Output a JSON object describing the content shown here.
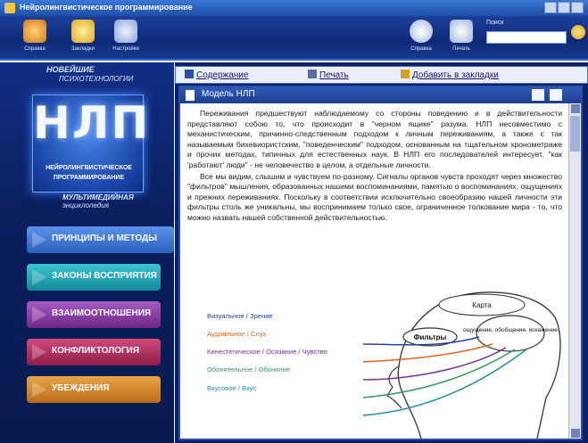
{
  "window": {
    "title": "Нейролингвистическое программирование"
  },
  "toolbar": {
    "buttons": [
      {
        "name": "home",
        "label": "Справка",
        "color": "#f0a437"
      },
      {
        "name": "bookmarks",
        "label": "Закладки",
        "color": "#f4d04b"
      },
      {
        "name": "settings",
        "label": "Настройки",
        "color": "#b9c9ee"
      },
      {
        "name": "help",
        "label": "Справка",
        "color": "#d8e2f7"
      },
      {
        "name": "print",
        "label": "Печать",
        "color": "#d8e2f7"
      }
    ],
    "search_label": "Поиск",
    "search_value": ""
  },
  "brand": {
    "top_line": "НОВЕЙШИЕ",
    "sub_line": "ПСИХОТЕХНОЛОГИИ",
    "logo": "НЛП",
    "logo_line1": "НЕЙРОЛИНГВИСТИЧЕСКОЕ",
    "logo_line2": "ПРОГРАММИРОВАНИЕ",
    "mm_line1": "МУЛЬТИМЕДИЙНАЯ",
    "mm_line2": "энциклопедия"
  },
  "nav": [
    {
      "label": "ПРИНЦИПЫ И МЕТОДЫ",
      "color": "#3f78d8",
      "active": true
    },
    {
      "label": "ЗАКОНЫ ВОСПРИЯТИЯ",
      "color": "#1fa8b8"
    },
    {
      "label": "ВЗАИМООТНОШЕНИЯ",
      "color": "#8a3da6"
    },
    {
      "label": "КОНФЛИКТОЛОГИЯ",
      "color": "#b3285c"
    },
    {
      "label": "УБЕЖДЕНИЯ",
      "color": "#d68a2a"
    }
  ],
  "links": {
    "contents": "Содержание",
    "print": "Печать",
    "bookmark": "Добавить в закладки"
  },
  "document": {
    "title": "Модель НЛП",
    "paragraph1": "Переживания предшествуют наблюдаемому со стороны поведению и в действительности представляют собою то, что происходит в \"черном ящике\" разума. НЛП несовместимо с механистическим, причинно-следственным подходом к личным переживаниям, а также с так называемым бихевиористским, \"поведенческим\" подходом, основанным на тщательном хронометраже и прочих методах, типичных для естественных наук. В НЛП его последователей интересует, \"как 'работают' люди\" - не человечество в целом, а отдельные личности.",
    "paragraph2": "Все мы видим, слышим и чувствуем по-разному. Сигналы органов чувств проходят через множество \"фильтров\" мышления, образованных нашими воспоминаниями, памятью о воспоминаниях, ощущениях и прежних переживаниях. Поскольку в соответствии исключительно своеобразию нашей личности эти фильтры столь же уникальны, мы воспринимаем только свое, ограниченное толкование мира - то, что можно назвать нашей собственной действительностью."
  },
  "legend": [
    {
      "label": "Визуальное / Зрение",
      "color": "#2a3f9c"
    },
    {
      "label": "Аудиальное / Слух",
      "color": "#e2651e"
    },
    {
      "label": "Кинестетическое / Осязание / Чувство",
      "color": "#7a2f94"
    },
    {
      "label": "Обонятельное / Обоняние",
      "color": "#2f9c5a"
    },
    {
      "label": "Вкусовое / Вкус",
      "color": "#1f8fa8"
    }
  ],
  "diagram": {
    "map_label": "Карта",
    "filters_label": "Фильтры",
    "experience_label": "ощущение, обобщение, искажение"
  }
}
